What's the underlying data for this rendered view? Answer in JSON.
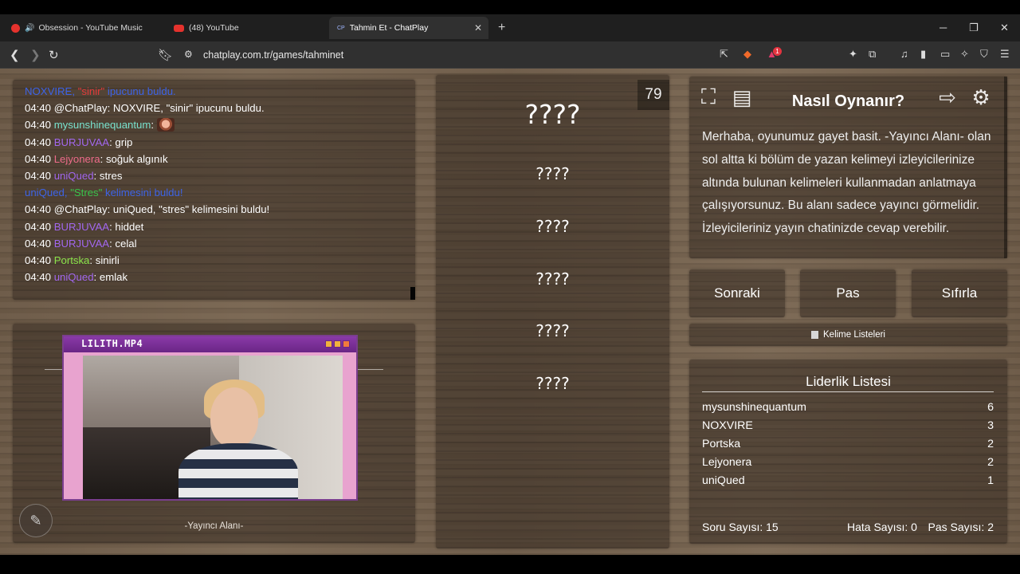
{
  "browser": {
    "tabs": [
      {
        "title": "Obsession - YouTube Music",
        "favicon": "youtube-music-icon",
        "active": false
      },
      {
        "title": "(48) YouTube",
        "favicon": "youtube-icon",
        "active": false
      },
      {
        "title": "Tahmin Et - ChatPlay",
        "favicon": "chatplay-icon",
        "favicon_text": "CP",
        "active": true
      }
    ],
    "url": "chatplay.com.tr/games/tahminet",
    "extension_badge": "1"
  },
  "chat": {
    "lines": [
      {
        "type": "sys",
        "parts": [
          {
            "text": "NOXVIRE, ",
            "color": ""
          },
          {
            "text": "\"sinir\"",
            "color": "red"
          },
          {
            "text": " ipucunu buldu.",
            "color": ""
          }
        ]
      },
      {
        "type": "msg",
        "time": "04:40",
        "user": "@ChatPlay",
        "user_color": "white",
        "text": "NOXVIRE, \"sinir\" ipucunu buldu."
      },
      {
        "type": "msg",
        "time": "04:40",
        "user": "mysunshinequantum",
        "user_color": "teal",
        "text": "",
        "emote": true
      },
      {
        "type": "msg",
        "time": "04:40",
        "user": "BURJUVAA",
        "user_color": "purple",
        "text": "grip"
      },
      {
        "type": "msg",
        "time": "04:40",
        "user": "Lejyonera",
        "user_color": "pink",
        "text": "soğuk algınık"
      },
      {
        "type": "msg",
        "time": "04:40",
        "user": "uniQued",
        "user_color": "purple",
        "text": "stres"
      },
      {
        "type": "sys",
        "parts": [
          {
            "text": "uniQued, ",
            "color": ""
          },
          {
            "text": "\"Stres\"",
            "color": "lime"
          },
          {
            "text": " kelimesini buldu!",
            "color": ""
          }
        ]
      },
      {
        "type": "msg",
        "time": "04:40",
        "user": "@ChatPlay",
        "user_color": "white",
        "text": "uniQued, \"stres\" kelimesini buldu!"
      },
      {
        "type": "msg",
        "time": "04:40",
        "user": "BURJUVAA",
        "user_color": "purple",
        "text": "hiddet"
      },
      {
        "type": "msg",
        "time": "04:40",
        "user": "BURJUVAA",
        "user_color": "purple",
        "text": "celal"
      },
      {
        "type": "msg",
        "time": "04:40",
        "user": "Portska",
        "user_color": "green",
        "text": "sinirli"
      },
      {
        "type": "msg",
        "time": "04:40",
        "user": "uniQued",
        "user_color": "purple",
        "text": "emlak"
      }
    ]
  },
  "streamer": {
    "cam_title": "LILITH.MP4",
    "label": "-Yayıncı Alanı-"
  },
  "game": {
    "timer": "79",
    "main_word": "????",
    "words": [
      "????",
      "????",
      "????",
      "????",
      "????"
    ]
  },
  "howto": {
    "title": "Nasıl Oynanır?",
    "text": "Merhaba, oyunumuz gayet basit. -Yayıncı Alanı- olan sol altta ki bölüm de yazan kelimeyi izleyicilerinize altında bulunan kelimeleri kullanmadan anlatmaya çalışıyorsunuz. Bu alanı sadece yayıncı görmelidir. İzleyicileriniz yayın chatinizde cevap verebilir."
  },
  "controls": {
    "next": "Sonraki",
    "pass": "Pas",
    "reset": "Sıfırla",
    "word_lists": "Kelime Listeleri"
  },
  "leaderboard": {
    "title": "Liderlik Listesi",
    "rows": [
      {
        "name": "mysunshinequantum",
        "score": "6"
      },
      {
        "name": "NOXVIRE",
        "score": "3"
      },
      {
        "name": "Portska",
        "score": "2"
      },
      {
        "name": "Lejyonera",
        "score": "2"
      },
      {
        "name": "uniQued",
        "score": "1"
      }
    ]
  },
  "stats": {
    "questions": "Soru Sayısı: 15",
    "errors": "Hata Sayısı: 0",
    "passes": "Pas Sayısı: 2"
  },
  "colors": {
    "user_purple": "#a267ee",
    "user_teal": "#79e3ce",
    "user_pink": "#ee6b8a",
    "user_green": "#8ae34a",
    "system_blue": "#3d63e6"
  }
}
